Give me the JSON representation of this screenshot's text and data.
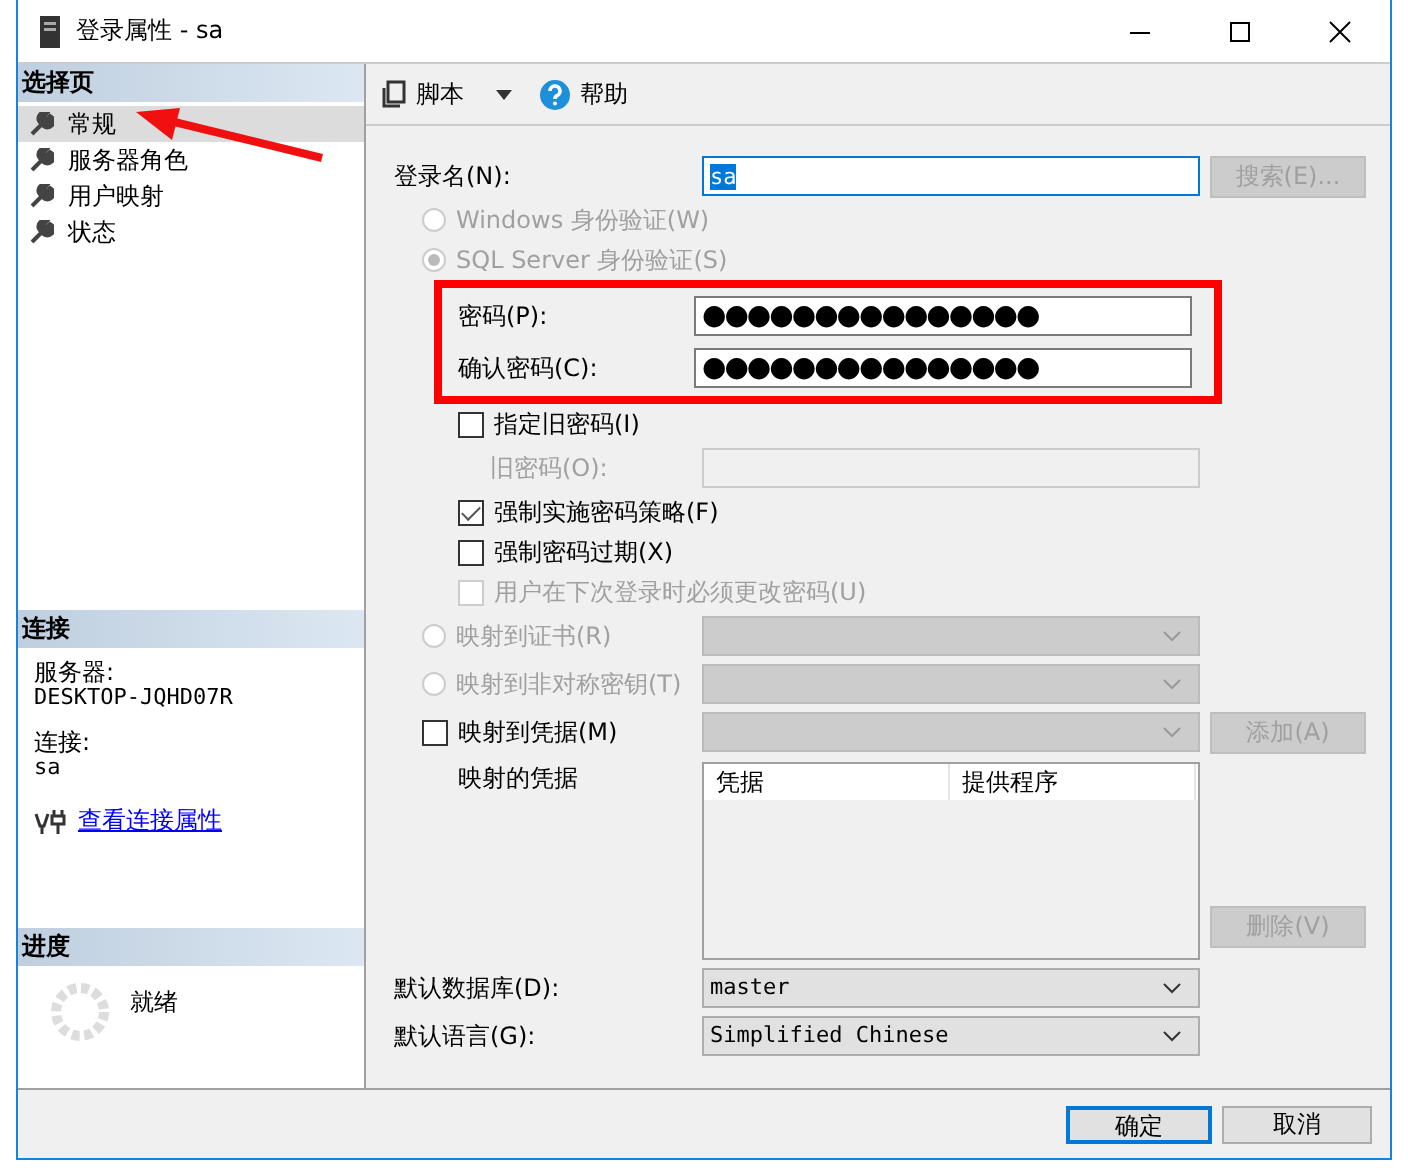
{
  "window": {
    "title": "登录属性 - sa"
  },
  "sidebar": {
    "pages_header": "选择页",
    "pages": [
      {
        "label": "常规",
        "selected": true
      },
      {
        "label": "服务器角色",
        "selected": false
      },
      {
        "label": "用户映射",
        "selected": false
      },
      {
        "label": "状态",
        "selected": false
      }
    ],
    "connection": {
      "header": "连接",
      "server_label": "服务器:",
      "server": "DESKTOP-JQHD07R",
      "connection_label": "连接:",
      "connection": "sa",
      "link": "查看连接属性"
    },
    "progress": {
      "header": "进度",
      "status": "就绪"
    }
  },
  "toolbar": {
    "script": "脚本",
    "help": "帮助"
  },
  "form": {
    "login_name": {
      "label": "登录名(N):",
      "value": "sa"
    },
    "search_button": {
      "label": "搜索(E)...",
      "disabled": true
    },
    "auth_options": [
      {
        "label": "Windows 身份验证(W)",
        "selected": false,
        "disabled": true
      },
      {
        "label": "SQL Server 身份验证(S)",
        "selected": true,
        "disabled": true
      }
    ],
    "password": {
      "label": "密码(P):",
      "value": "●●●●●●●●●●●●●●●"
    },
    "confirm_password": {
      "label": "确认密码(C):",
      "value": "●●●●●●●●●●●●●●●"
    },
    "specify_old_password": {
      "label": "指定旧密码(I)",
      "checked": false
    },
    "old_password": {
      "label": "旧密码(O):",
      "disabled": true
    },
    "policy_options": [
      {
        "label": "强制实施密码策略(F)",
        "checked": true,
        "disabled": false
      },
      {
        "label": "强制密码过期(X)",
        "checked": false,
        "disabled": false
      },
      {
        "label": "用户在下次登录时必须更改密码(U)",
        "checked": false,
        "disabled": true
      }
    ],
    "mapping_options": [
      {
        "kind": "radio",
        "label": "映射到证书(R)",
        "selected": false,
        "disabled": true
      },
      {
        "kind": "radio",
        "label": "映射到非对称密钥(T)",
        "selected": false,
        "disabled": true
      },
      {
        "kind": "checkbox",
        "label": "映射到凭据(M)",
        "checked": false,
        "disabled": false
      }
    ],
    "add_button": {
      "label": "添加(A)",
      "disabled": true
    },
    "mapped_credentials": {
      "label": "映射的凭据",
      "columns": [
        "凭据",
        "提供程序"
      ]
    },
    "remove_button": {
      "label": "删除(V)",
      "disabled": true
    },
    "default_database": {
      "label": "默认数据库(D):",
      "value": "master"
    },
    "default_language": {
      "label": "默认语言(G):",
      "value": "Simplified Chinese"
    }
  },
  "buttons": [
    {
      "label": "确定",
      "default": true
    },
    {
      "label": "取消",
      "default": false
    }
  ]
}
